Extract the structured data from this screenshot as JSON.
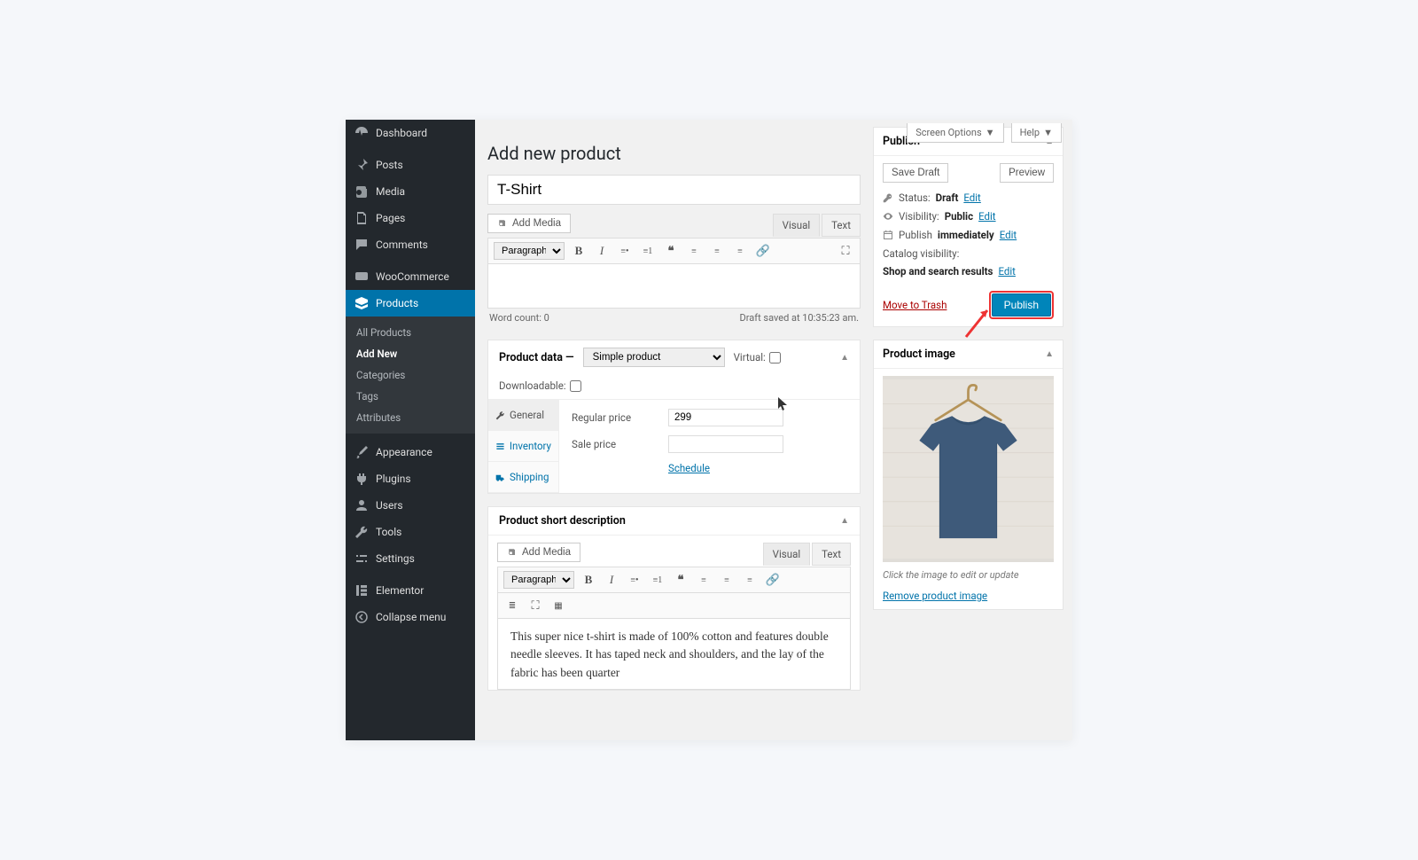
{
  "sidebar": {
    "dashboard": "Dashboard",
    "posts": "Posts",
    "media": "Media",
    "pages": "Pages",
    "comments": "Comments",
    "woocommerce": "WooCommerce",
    "products": "Products",
    "sub": {
      "all_products": "All Products",
      "add_new": "Add New",
      "categories": "Categories",
      "tags": "Tags",
      "attributes": "Attributes"
    },
    "appearance": "Appearance",
    "plugins": "Plugins",
    "users": "Users",
    "tools": "Tools",
    "settings": "Settings",
    "elementor": "Elementor",
    "collapse": "Collapse menu"
  },
  "top": {
    "screen_options": "Screen Options",
    "help": "Help"
  },
  "page": {
    "title": "Add new product",
    "product_title": "T-Shirt",
    "add_media": "Add Media",
    "visual": "Visual",
    "text": "Text",
    "paragraph": "Paragraph",
    "word_count": "Word count: 0",
    "draft_saved": "Draft saved at 10:35:23 am."
  },
  "product_data": {
    "head": "Product data —",
    "type": "Simple product",
    "virtual": "Virtual:",
    "downloadable": "Downloadable:",
    "tabs": {
      "general": "General",
      "inventory": "Inventory",
      "shipping": "Shipping"
    },
    "regular_price_label": "Regular price",
    "regular_price": "299",
    "sale_price_label": "Sale price",
    "sale_price": "",
    "schedule": "Schedule"
  },
  "short_desc": {
    "title": "Product short description",
    "text": "This super nice t-shirt is made of 100% cotton and features double needle sleeves. It has taped neck and shoulders, and the lay of the fabric has been quarter"
  },
  "publish": {
    "title": "Publish",
    "save_draft": "Save Draft",
    "preview": "Preview",
    "status_label": "Status:",
    "status_value": "Draft",
    "visibility_label": "Visibility:",
    "visibility_value": "Public",
    "publish_label": "Publish",
    "publish_value": "immediately",
    "catalog_label": "Catalog visibility:",
    "catalog_value": "Shop and search results",
    "edit": "Edit",
    "move_trash": "Move to Trash",
    "publish_btn": "Publish"
  },
  "prodimg": {
    "title": "Product image",
    "caption": "Click the image to edit or update",
    "remove": "Remove product image"
  }
}
